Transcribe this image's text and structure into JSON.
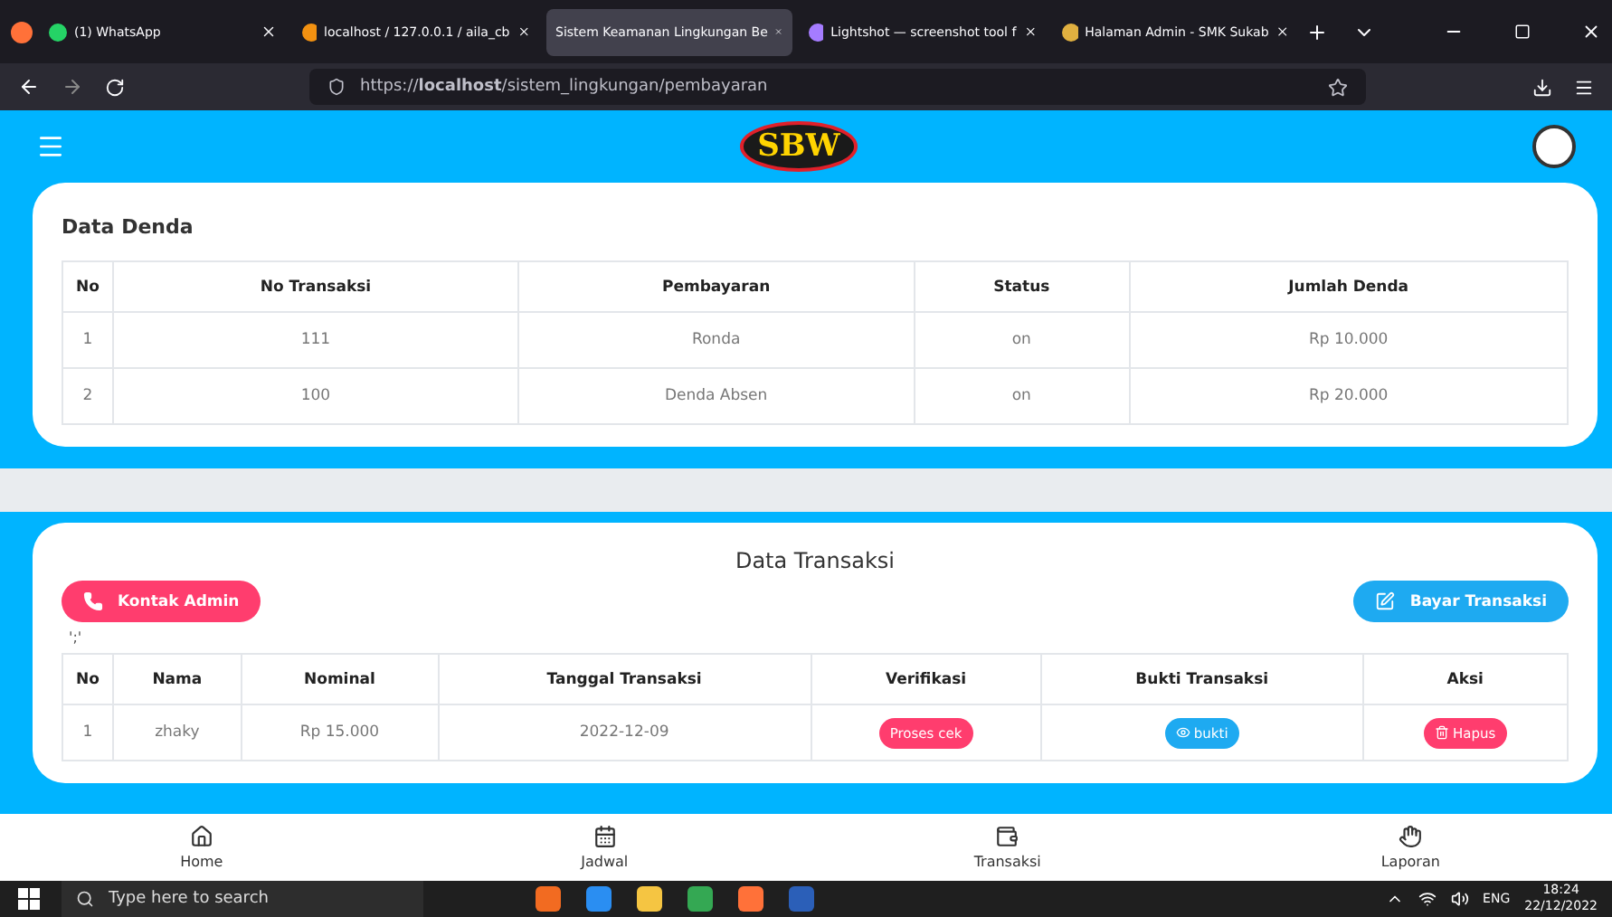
{
  "browser": {
    "tabs": [
      {
        "title": "(1) WhatsApp",
        "selected": false
      },
      {
        "title": "localhost / 127.0.0.1 / aila_cb",
        "selected": false
      },
      {
        "title": "Sistem Keamanan Lingkungan Be",
        "selected": true
      },
      {
        "title": "Lightshot — screenshot tool f",
        "selected": false
      },
      {
        "title": "Halaman Admin - SMK Sukab",
        "selected": false
      }
    ],
    "url": "https://**localhost**/sistem_lingkungan/pembayaran"
  },
  "header": {
    "logo_text": "SBW"
  },
  "denda": {
    "title": "Data Denda",
    "columns": [
      "No",
      "No Transaksi",
      "Pembayaran",
      "Status",
      "Jumlah Denda"
    ],
    "rows": [
      [
        "1",
        "111",
        "Ronda",
        "on",
        "Rp 10.000"
      ],
      [
        "2",
        "100",
        "Denda Absen",
        "on",
        "Rp 20.000"
      ]
    ]
  },
  "transaksi": {
    "title": "Data Transaksi",
    "contact_button": "Kontak Admin",
    "pay_button": "Bayar Transaksi",
    "note": "';'",
    "columns": [
      "No",
      "Nama",
      "Nominal",
      "Tanggal Transaksi",
      "Verifikasi",
      "Bukti Transaksi",
      "Aksi"
    ],
    "rows": [
      {
        "no": "1",
        "nama": "zhaky",
        "nominal": "Rp 15.000",
        "tanggal": "2022-12-09",
        "verifikasi": "Proses cek",
        "bukti": "bukti",
        "aksi": "Hapus"
      }
    ]
  },
  "bottom_nav": [
    {
      "label": "Home"
    },
    {
      "label": "Jadwal"
    },
    {
      "label": "Transaksi"
    },
    {
      "label": "Laporan"
    }
  ],
  "taskbar": {
    "search_placeholder": "Type here to search",
    "language": "ENG",
    "time": "18:24",
    "date": "22/12/2022"
  }
}
